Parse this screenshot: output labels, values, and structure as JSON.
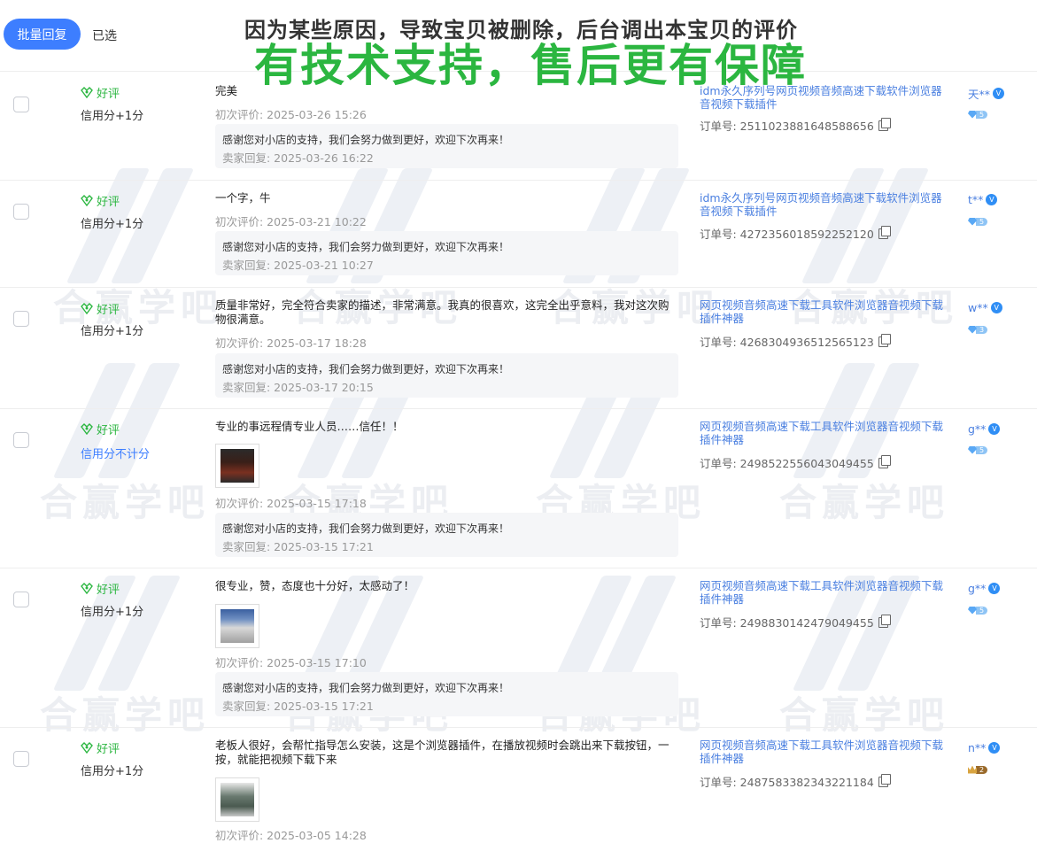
{
  "toolbar": {
    "batch_reply_label": "批量回复",
    "selected_label": "已选"
  },
  "banner": {
    "line1": "因为某些原因，导致宝贝被删除，后台调出本宝贝的评价",
    "line2": "有技术支持，售后更有保障"
  },
  "watermark": {
    "text": "合赢学吧"
  },
  "colors": {
    "accent": "#3d7eff",
    "good": "#2bb640",
    "banner_green": "#2bb640",
    "link": "#4a7fe0"
  },
  "reviews": [
    {
      "rating": "好评",
      "credit": "信用分+1分",
      "content": "完美",
      "has_image": false,
      "first_time": "初次评价: 2025-03-26 15:26",
      "reply_text": "感谢您对小店的支持，我们会努力做到更好，欢迎下次再来！",
      "reply_time": "卖家回复: 2025-03-26 16:22",
      "product": "idm永久序列号网页视频音频高速下载软件浏览器音视频下载插件",
      "order": "订单号: 2511023881648588656",
      "buyer": "天**",
      "level": "5"
    },
    {
      "rating": "好评",
      "credit": "信用分+1分",
      "content": "一个字，牛",
      "has_image": false,
      "first_time": "初次评价: 2025-03-21 10:22",
      "reply_text": "感谢您对小店的支持，我们会努力做到更好，欢迎下次再来！",
      "reply_time": "卖家回复: 2025-03-21 10:27",
      "product": "idm永久序列号网页视频音频高速下载软件浏览器音视频下载插件",
      "order": "订单号: 4272356018592252120",
      "buyer": "t**",
      "level": "5"
    },
    {
      "rating": "好评",
      "credit": "信用分+1分",
      "content": "质量非常好，完全符合卖家的描述，非常满意。我真的很喜欢，这完全出乎意料，我对这次购物很满意。",
      "has_image": false,
      "first_time": "初次评价: 2025-03-17 18:28",
      "reply_text": "感谢您对小店的支持，我们会努力做到更好，欢迎下次再来！",
      "reply_time": "卖家回复: 2025-03-17 20:15",
      "product": "网页视频音频高速下载工具软件浏览器音视频下载插件神器",
      "order": "订单号: 4268304936512565123",
      "buyer": "w**",
      "level": "3"
    },
    {
      "rating": "好评",
      "credit": "信用分不计分",
      "content": "专业的事远程倩专业人员……信任！！",
      "has_image": true,
      "first_time": "初次评价: 2025-03-15 17:18",
      "reply_text": "感谢您对小店的支持，我们会努力做到更好，欢迎下次再来！",
      "reply_time": "卖家回复: 2025-03-15 17:21",
      "product": "网页视频音频高速下载工具软件浏览器音视频下载插件神器",
      "order": "订单号: 2498522556043049455",
      "buyer": "g**",
      "level": "5"
    },
    {
      "rating": "好评",
      "credit": "信用分+1分",
      "content": "很专业，赞，态度也十分好，太感动了！",
      "has_image": true,
      "first_time": "初次评价: 2025-03-15 17:10",
      "reply_text": "感谢您对小店的支持，我们会努力做到更好，欢迎下次再来！",
      "reply_time": "卖家回复: 2025-03-15 17:21",
      "product": "网页视频音频高速下载工具软件浏览器音视频下载插件神器",
      "order": "订单号: 2498830142479049455",
      "buyer": "g**",
      "level": "5"
    },
    {
      "rating": "好评",
      "credit": "信用分+1分",
      "content": "老板人很好，会帮忙指导怎么安装，这是个浏览器插件，在播放视频时会跳出来下载按钮，一按，就能把视频下载下来",
      "has_image": true,
      "first_time": "初次评价: 2025-03-05 14:28",
      "reply_text": "",
      "reply_time": "",
      "product": "网页视频音频高速下载工具软件浏览器音视频下载插件神器",
      "order": "订单号: 2487583382343221184",
      "buyer": "n**",
      "level": "2"
    }
  ]
}
